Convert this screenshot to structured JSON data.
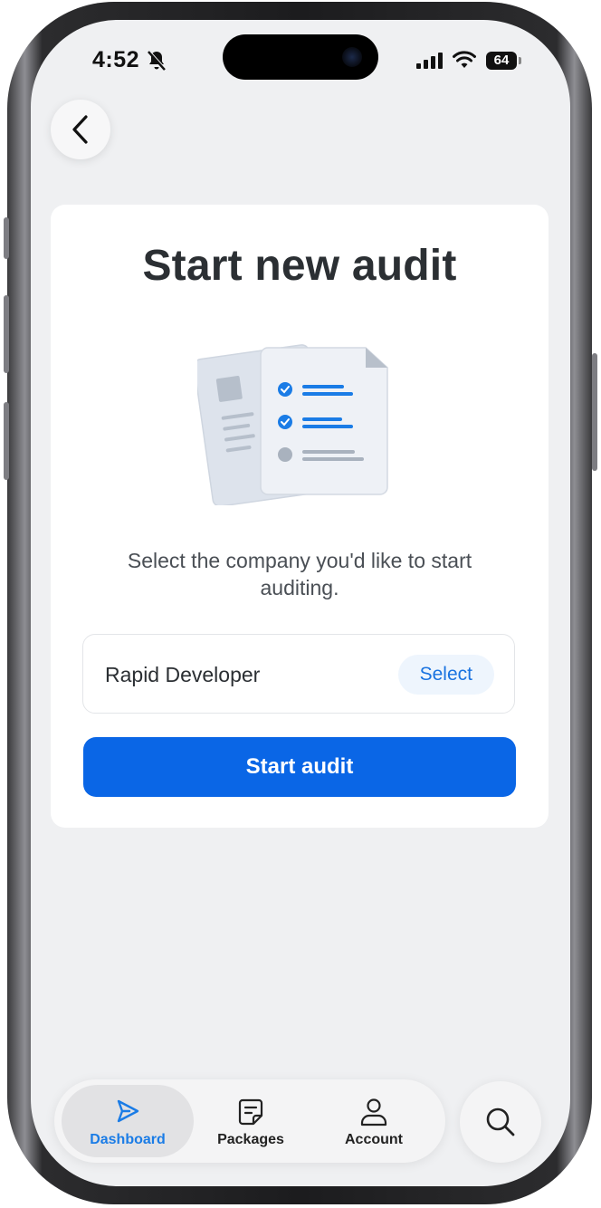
{
  "status_bar": {
    "time": "4:52",
    "battery": "64"
  },
  "page": {
    "title": "Start new audit",
    "subtitle": "Select the company you'd like to start auditing."
  },
  "company_field": {
    "value": "Rapid Developer",
    "select_label": "Select"
  },
  "actions": {
    "start_label": "Start audit"
  },
  "tab_bar": {
    "items": [
      {
        "label": "Dashboard",
        "icon": "send-icon",
        "active": true
      },
      {
        "label": "Packages",
        "icon": "note-icon",
        "active": false
      },
      {
        "label": "Account",
        "icon": "user-icon",
        "active": false
      }
    ],
    "search_icon": "search-icon"
  },
  "colors": {
    "accent": "#0a66e6",
    "active_tab": "#1a7ce6",
    "background": "#eff0f2"
  }
}
